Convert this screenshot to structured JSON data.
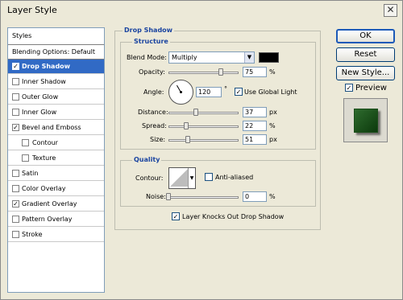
{
  "window": {
    "title": "Layer Style",
    "close_glyph": "✕"
  },
  "styles_list": {
    "header": "Styles",
    "blending_options": "Blending Options: Default",
    "items": [
      {
        "label": "Drop Shadow",
        "checked": true,
        "selected": true,
        "indent": false
      },
      {
        "label": "Inner Shadow",
        "checked": false,
        "selected": false,
        "indent": false
      },
      {
        "label": "Outer Glow",
        "checked": false,
        "selected": false,
        "indent": false
      },
      {
        "label": "Inner Glow",
        "checked": false,
        "selected": false,
        "indent": false
      },
      {
        "label": "Bevel and Emboss",
        "checked": true,
        "selected": false,
        "indent": false
      },
      {
        "label": "Contour",
        "checked": false,
        "selected": false,
        "indent": true
      },
      {
        "label": "Texture",
        "checked": false,
        "selected": false,
        "indent": true
      },
      {
        "label": "Satin",
        "checked": false,
        "selected": false,
        "indent": false
      },
      {
        "label": "Color Overlay",
        "checked": false,
        "selected": false,
        "indent": false
      },
      {
        "label": "Gradient Overlay",
        "checked": true,
        "selected": false,
        "indent": false
      },
      {
        "label": "Pattern Overlay",
        "checked": false,
        "selected": false,
        "indent": false
      },
      {
        "label": "Stroke",
        "checked": false,
        "selected": false,
        "indent": false
      }
    ]
  },
  "drop_shadow": {
    "title": "Drop Shadow",
    "structure": {
      "title": "Structure",
      "blend_mode_label": "Blend Mode:",
      "blend_mode_value": "Multiply",
      "shadow_color": "#000000",
      "opacity_label": "Opacity:",
      "opacity_value": "75",
      "opacity_unit": "%",
      "angle_label": "Angle:",
      "angle_value": "120",
      "angle_unit": "°",
      "use_global_light_label": "Use Global Light",
      "use_global_light": true,
      "distance_label": "Distance:",
      "distance_value": "37",
      "distance_unit": "px",
      "spread_label": "Spread:",
      "spread_value": "22",
      "spread_unit": "%",
      "size_label": "Size:",
      "size_value": "51",
      "size_unit": "px"
    },
    "quality": {
      "title": "Quality",
      "contour_label": "Contour:",
      "anti_aliased_label": "Anti-aliased",
      "anti_aliased": false,
      "noise_label": "Noise:",
      "noise_value": "0",
      "noise_unit": "%"
    },
    "knocks_out_label": "Layer Knocks Out Drop Shadow",
    "knocks_out": true
  },
  "buttons": {
    "ok": "OK",
    "reset": "Reset",
    "new_style": "New Style...",
    "preview_label": "Preview",
    "preview_checked": true
  },
  "colors": {
    "selection": "#316ac5",
    "group_title": "#1a44a0",
    "preview_fill": "#1e5a1e"
  }
}
